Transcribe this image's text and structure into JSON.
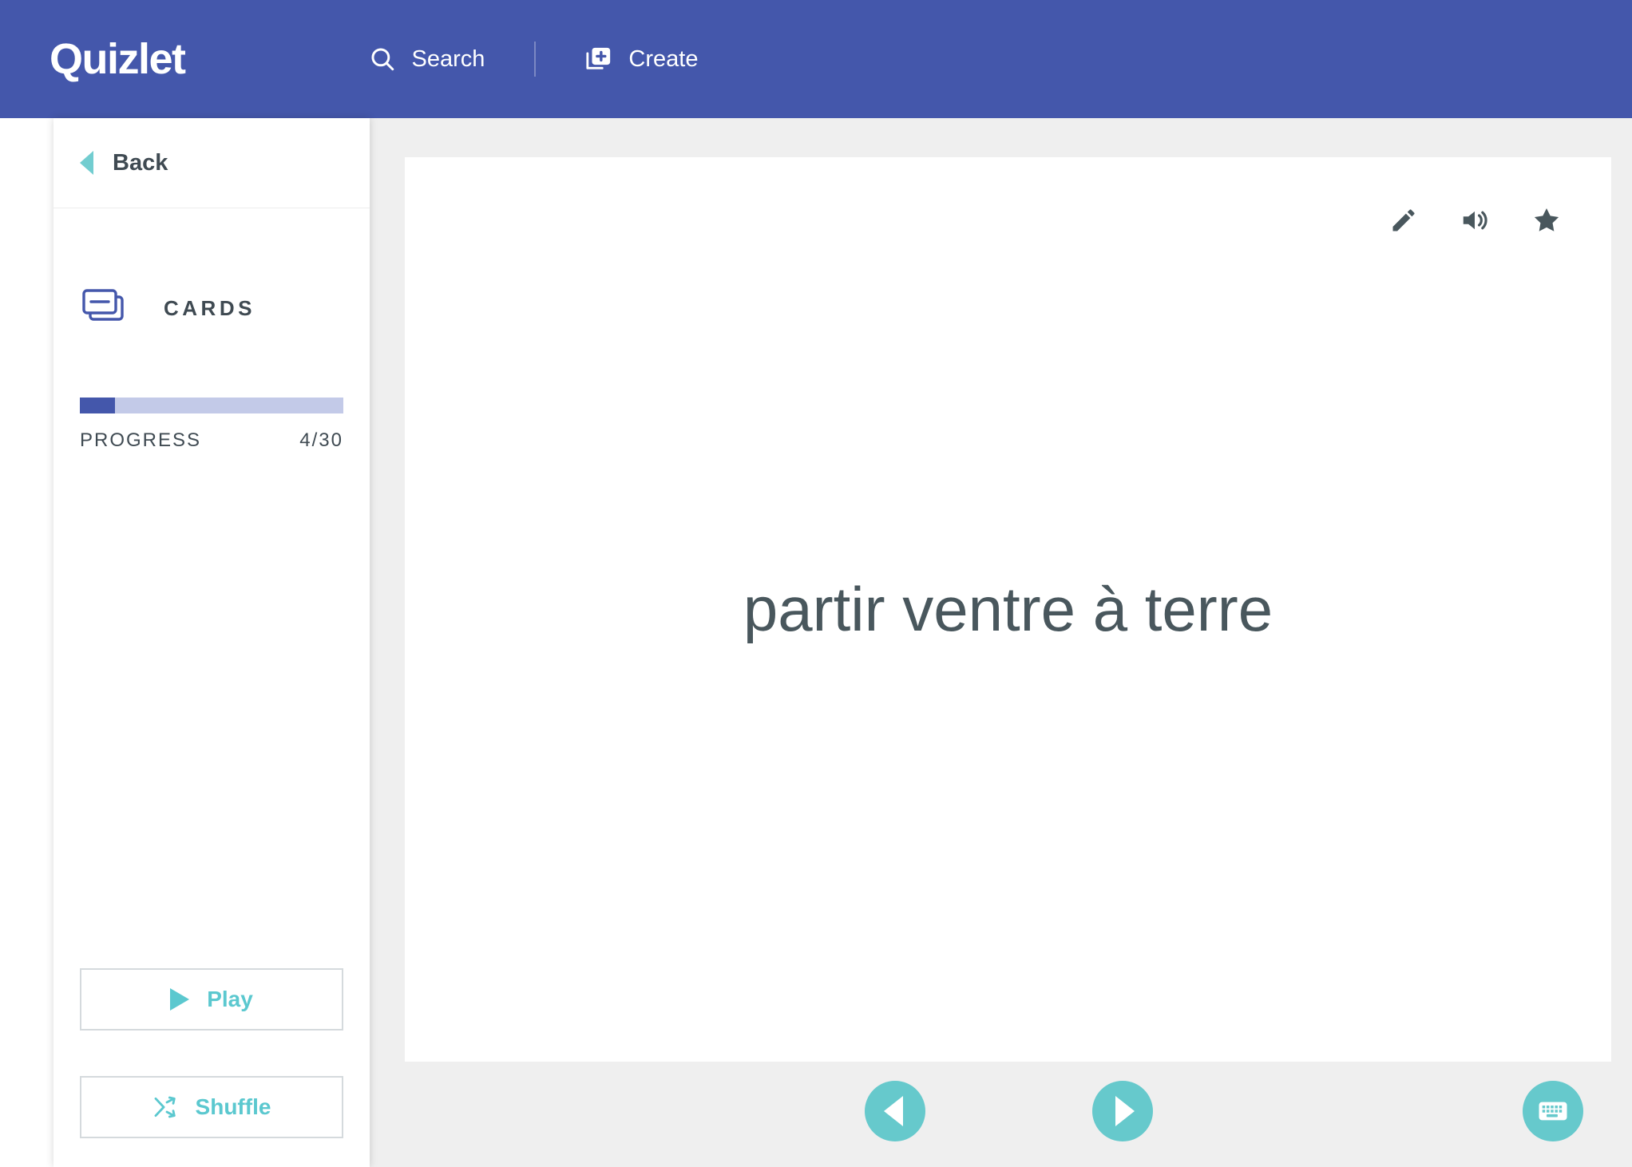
{
  "header": {
    "logo": "Quizlet",
    "search_label": "Search",
    "search_icon": "search-icon",
    "create_label": "Create",
    "create_icon": "create-card-icon"
  },
  "sidebar": {
    "back_label": "Back",
    "back_icon": "triangle-left-icon",
    "section_label": "CARDS",
    "section_icon": "cards-stack-icon",
    "progress": {
      "label": "PROGRESS",
      "count": "4/30",
      "current": 4,
      "total": 30,
      "percent": 13.3,
      "fill_color": "#4457ab",
      "track_color": "#c3cae8"
    },
    "buttons": [
      {
        "label": "Play",
        "icon": "play-triangle-icon"
      },
      {
        "label": "Shuffle",
        "icon": "shuffle-arrows-icon"
      }
    ]
  },
  "main": {
    "card": {
      "term": "partir ventre à terre",
      "actions": [
        {
          "name": "edit-icon",
          "label": "Edit"
        },
        {
          "name": "audio-icon",
          "label": "Play audio"
        },
        {
          "name": "star-icon",
          "label": "Star"
        }
      ]
    },
    "controls": [
      {
        "name": "previous-card-button",
        "icon": "triangle-left-icon"
      },
      {
        "name": "next-card-button",
        "icon": "triangle-right-icon"
      },
      {
        "name": "keyboard-shortcuts-button",
        "icon": "keyboard-icon"
      }
    ]
  },
  "colors": {
    "brand_indigo": "#4457ab",
    "teal": "#66c9cc",
    "teal_light": "#5bc8cf",
    "slate": "#3f4a52",
    "card_text": "#49575d",
    "page_bg": "#efefef"
  }
}
